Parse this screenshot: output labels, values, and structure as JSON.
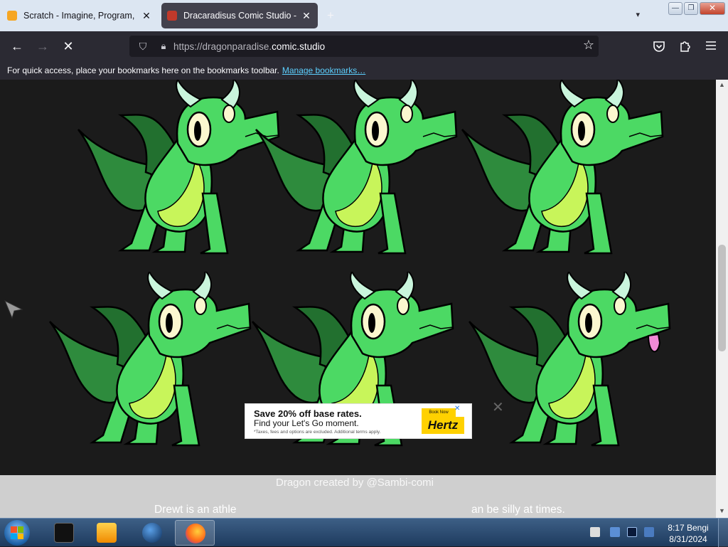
{
  "browser": {
    "tabs": [
      {
        "title": "Scratch - Imagine, Program, Sh",
        "active": false,
        "close": "✕"
      },
      {
        "title": "Dracaradisus Comic Studio - m",
        "active": true,
        "close": "✕"
      }
    ],
    "new_tab": "+",
    "window_buttons": {
      "minimize": "—",
      "restore": "❐",
      "close": "✕"
    },
    "nav": {
      "back": "←",
      "forward": "→",
      "stop": "✕"
    },
    "url": {
      "prefix": "https://dragonparadise.",
      "domain": "comic.studio"
    },
    "toolbar_icons": [
      "pocket-icon",
      "extensions-icon",
      "menu-icon"
    ],
    "bookmarks_bar": {
      "message": "For quick access, place your bookmarks here on the bookmarks toolbar.",
      "link": "Manage bookmarks…"
    }
  },
  "page": {
    "caption_top": "Dragon created by @Sambi-comi",
    "caption_bottom_left": "Drewt is an athle",
    "caption_bottom_right": "an be silly at times.",
    "ad": {
      "headline": "Save 20% off base rates.",
      "subline": "Find your Let's Go moment.",
      "fineprint": "*Taxes, fees and options are excluded. Additional terms apply.",
      "cta": "Book Now",
      "brand": "Hertz",
      "close": "✕"
    },
    "ad_dismiss": "✕",
    "colors": {
      "dragon_body": "#4cd964",
      "dragon_belly": "#c8f55a",
      "dragon_dark": "#2e8b3d",
      "horn": "#c9f5dc",
      "background": "#1b1b1b"
    }
  },
  "taskbar": {
    "clock_time": "8:17 Bengi",
    "clock_date": "8/31/2024",
    "pinned": [
      "terminal-icon",
      "media-player-icon",
      "globe-icon",
      "firefox-icon"
    ]
  }
}
